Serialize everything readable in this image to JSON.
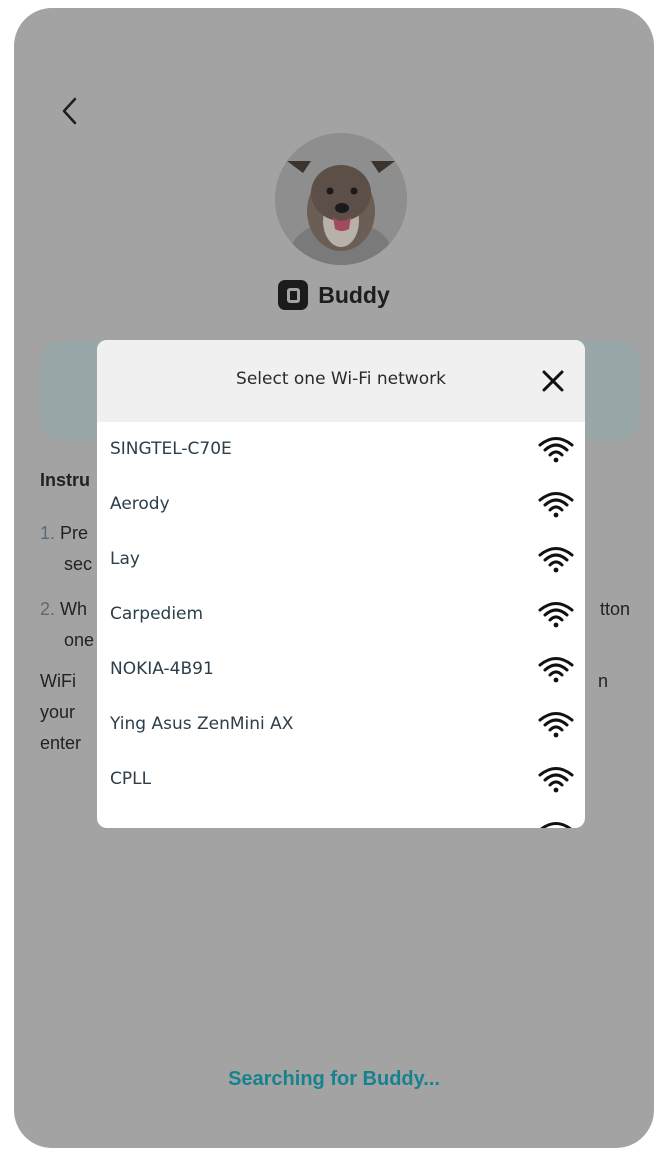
{
  "device": {
    "name": "Buddy"
  },
  "instructions": {
    "title": "Instru",
    "step1_num": "1.",
    "step1_line1": "Pre",
    "step1_line2": "sec",
    "step2_num": "2.",
    "step2_line1": "Wh",
    "step2_line1_tail": "tton",
    "step2_line2": "one",
    "para_line1": "WiFi",
    "para_line1_tail": "n",
    "para_line2": "your",
    "para_line3": "enter"
  },
  "status": {
    "searching": "Searching for Buddy..."
  },
  "wifi_modal": {
    "title": "Select one Wi-Fi network",
    "networks": [
      {
        "name": "SINGTEL-C70E",
        "icon": "wifi-icon"
      },
      {
        "name": "Aerody",
        "icon": "wifi-icon"
      },
      {
        "name": "Lay",
        "icon": "wifi-icon"
      },
      {
        "name": "Carpediem",
        "icon": "wifi-icon"
      },
      {
        "name": "NOKIA-4B91",
        "icon": "wifi-icon"
      },
      {
        "name": "Ying Asus ZenMini AX",
        "icon": "wifi-icon"
      },
      {
        "name": "CPLL",
        "icon": "wifi-icon"
      }
    ]
  },
  "colors": {
    "overlay": "#a3a3a3",
    "accent_teal": "#17828f",
    "modal_header": "#f0f0f0"
  }
}
